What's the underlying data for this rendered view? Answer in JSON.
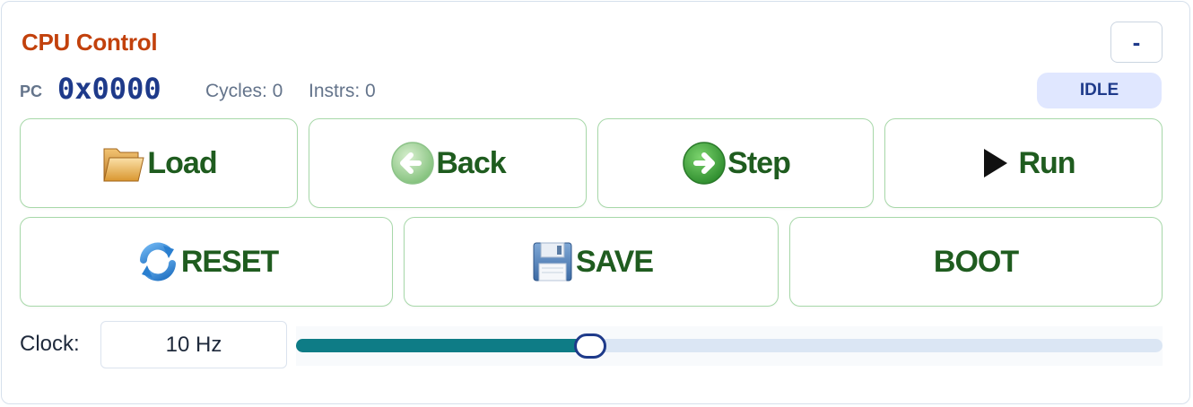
{
  "panel": {
    "title": "CPU Control",
    "collapse_label": "-"
  },
  "registers": {
    "pc_label": "PC",
    "pc_value": "0x0000",
    "cycles": "Cycles: 0",
    "instrs": "Instrs: 0"
  },
  "status": {
    "label": "IDLE"
  },
  "buttons_row1": [
    {
      "label": "Load",
      "icon": "folder-icon"
    },
    {
      "label": "Back",
      "icon": "back-arrow-icon"
    },
    {
      "label": "Step",
      "icon": "step-arrow-icon"
    },
    {
      "label": "Run",
      "icon": "play-icon"
    }
  ],
  "buttons_row2": [
    {
      "label": "RESET",
      "icon": "refresh-icon"
    },
    {
      "label": "SAVE",
      "icon": "floppy-disk-icon"
    },
    {
      "label": "BOOT",
      "icon": ""
    }
  ],
  "clock": {
    "label": "Clock:",
    "value": "10 Hz",
    "slider_fraction": 0.34
  },
  "colors": {
    "title": "#c2410c",
    "accent": "#1e3a8a",
    "button_text": "#1f5c1f",
    "button_border": "#a7d8a9",
    "slider_fill": "#0e7c86"
  }
}
